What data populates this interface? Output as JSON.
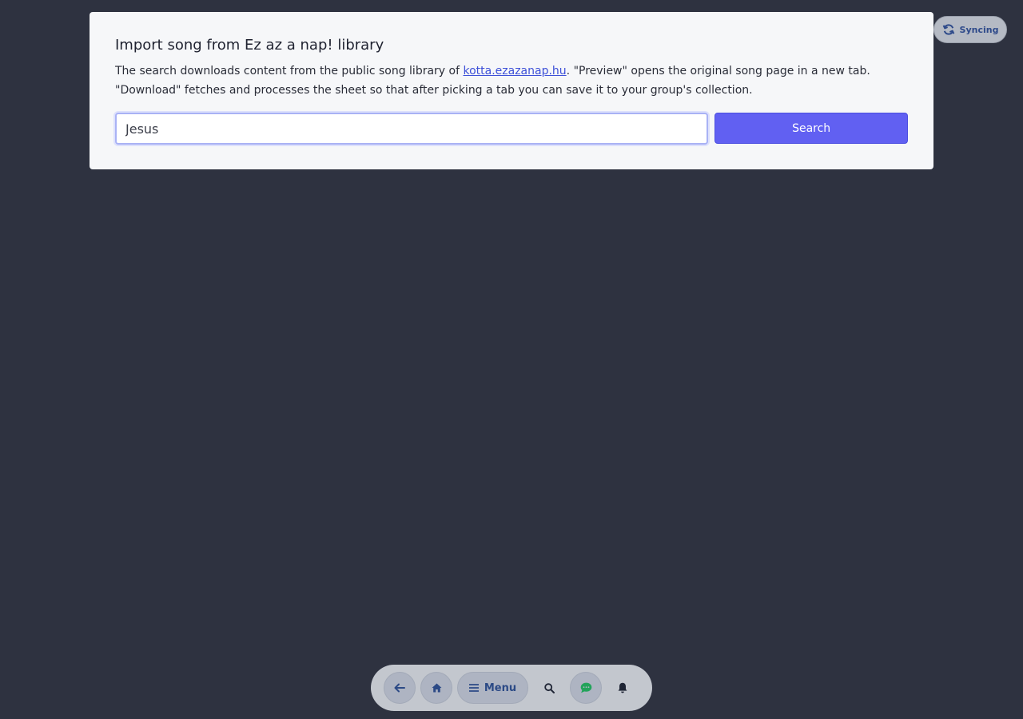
{
  "import": {
    "title": "Import song from Ez az a nap! library",
    "desc_before": "The search downloads content from the public song library of ",
    "desc_link": "kotta.ezazanap.hu",
    "desc_after": ". \"Preview\" opens the original song page in a new tab. \"Download\" fetches and processes the sheet so that after picking a tab you can save it to your group's collection.",
    "search_value": "Jesus",
    "search_button": "Search"
  },
  "status": {
    "sync_label": "Syncing",
    "icon": "sync-icon"
  },
  "nav": {
    "menu_label": "Menu",
    "icons": [
      "arrow-left-icon",
      "home-icon",
      "hamburger-icon",
      "search-icon",
      "chat-icon",
      "bell-icon"
    ]
  },
  "colors": {
    "background": "#2e3240",
    "accent": "#6160f2",
    "link": "#3d50d8",
    "chat_green": "#22a35a"
  }
}
